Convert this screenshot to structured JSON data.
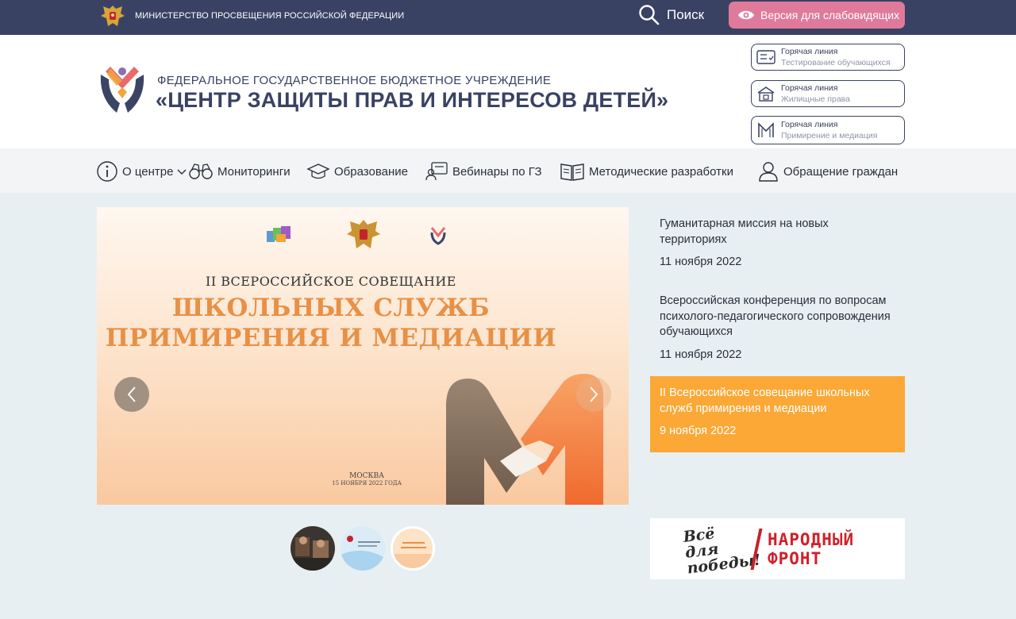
{
  "topbar": {
    "ministry_label": "МИНИСТЕРСТВО ПРОСВЕЩЕНИЯ РОССИЙСКОЙ ФЕДЕРАЦИИ",
    "search_label": "Поиск",
    "vision_label": "Версия для слабовидящих"
  },
  "header": {
    "subtitle": "ФЕДЕРАЛЬНОЕ ГОСУДАРСТВЕННОЕ БЮДЖЕТНОЕ УЧРЕЖДЕНИЕ",
    "title": "«ЦЕНТР ЗАЩИТЫ ПРАВ И ИНТЕРЕСОВ ДЕТЕЙ»",
    "hotlines": [
      {
        "title": "Горячая линия",
        "subtitle": "Тестирование обучающихся",
        "icon": "checklist-icon"
      },
      {
        "title": "Горячая линия",
        "subtitle": "Жилищные права",
        "icon": "house-icon"
      },
      {
        "title": "Горячая линия",
        "subtitle": "Примирение и медиация",
        "icon": "mediation-icon"
      }
    ]
  },
  "nav": {
    "items": [
      {
        "label": "О центре",
        "icon": "info-icon"
      },
      {
        "label": "Мониторинги",
        "icon": "binoculars-icon"
      },
      {
        "label": "Образование",
        "icon": "graduation-cap-icon"
      },
      {
        "label": "Вебинары по ГЗ",
        "icon": "webinar-icon"
      },
      {
        "label": "Методические разработки",
        "icon": "book-icon"
      },
      {
        "label": "Обращение граждан",
        "icon": "person-icon"
      }
    ]
  },
  "slide": {
    "heading": "II ВСЕРОССИЙСКОЕ СОВЕЩАНИЕ",
    "title_line1": "ШКОЛЬНЫХ СЛУЖБ",
    "title_line2": "ПРИМИРЕНИЯ И МЕДИАЦИИ",
    "city": "МОСКВА",
    "date": "15 НОЯБРЯ 2022 ГОДА"
  },
  "news": [
    {
      "title": "Гуманитарная миссия на новых территориях",
      "date": "11 ноября 2022",
      "active": false
    },
    {
      "title": "Всероссийская конференция по вопросам психолого-педагогического сопровождения обучающихся",
      "date": "11 ноября 2022",
      "active": false
    },
    {
      "title": "II Всероссийское совещание школьных служб примирения и медиации",
      "date": "9 ноября 2022",
      "active": true
    }
  ],
  "banner": {
    "left_text": "Всё для победы!",
    "right_text_line1": "НАРОДНЫЙ",
    "right_text_line2": "ФРОНТ"
  },
  "colors": {
    "topbar": "#394263",
    "vision_button": "#e07a9a",
    "active_news": "#fba836",
    "page_bg": "#e8eff2"
  }
}
